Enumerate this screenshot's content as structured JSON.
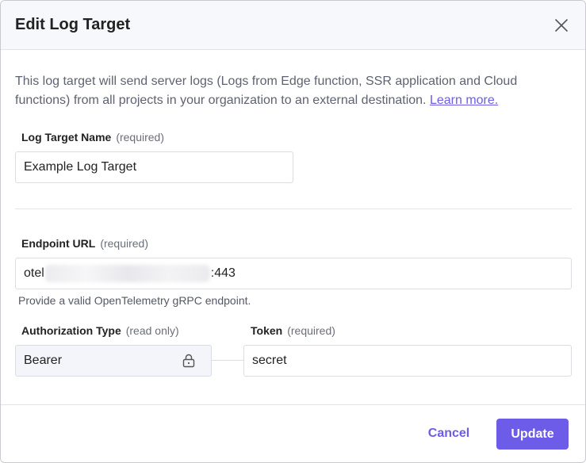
{
  "dialog": {
    "title": "Edit Log Target",
    "description": "This log target will send server logs (Logs from Edge function, SSR application and Cloud functions) from all projects in your organization to an external destination.",
    "learn_more": "Learn more."
  },
  "fields": {
    "name": {
      "label": "Log Target Name",
      "qualifier": "(required)",
      "value": "Example Log Target"
    },
    "endpoint": {
      "label": "Endpoint URL",
      "qualifier": "(required)",
      "value_prefix": "otel",
      "value_suffix": ":443",
      "helper": "Provide a valid OpenTelemetry gRPC endpoint."
    },
    "auth_type": {
      "label": "Authorization Type",
      "qualifier": "(read only)",
      "value": "Bearer"
    },
    "token": {
      "label": "Token",
      "qualifier": "(required)",
      "value": "secret"
    }
  },
  "footer": {
    "cancel_label": "Cancel",
    "update_label": "Update"
  },
  "colors": {
    "accent": "#6c5ce7",
    "header_bg": "#f7f8fb",
    "readonly_bg": "#f4f5fa"
  },
  "icons": {
    "close": "close-icon",
    "lock": "lock-icon"
  }
}
